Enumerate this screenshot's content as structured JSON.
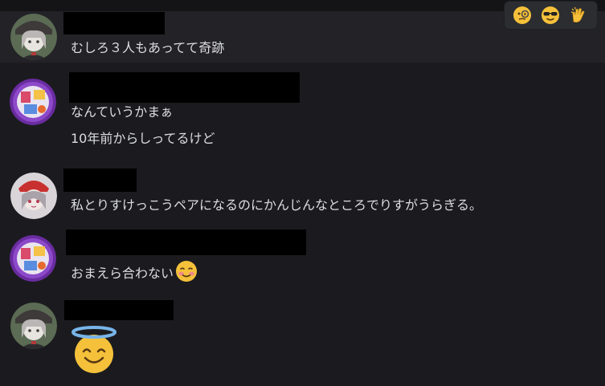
{
  "reactions": [
    {
      "name": "monocle-face"
    },
    {
      "name": "sunglasses-face"
    },
    {
      "name": "clapping-hands"
    }
  ],
  "messages": [
    {
      "lines": [
        "むしろ３人もあってて奇跡"
      ]
    },
    {
      "lines": [
        "なんていうかまぁ",
        "10年前からしってるけど"
      ]
    },
    {
      "lines": [
        "私とりすけっこうペアになるのにかんじんなところでりすがうらぎる。"
      ]
    },
    {
      "lines": [
        "おまえら合わない"
      ],
      "emoji": "smiling-face-blushing"
    },
    {
      "lines": [],
      "emoji": "smiling-face-with-halo"
    }
  ],
  "colors": {
    "background": "#1b1b1f",
    "hover_row": "#222227",
    "text": "#dcddde",
    "redaction": "#000000"
  }
}
